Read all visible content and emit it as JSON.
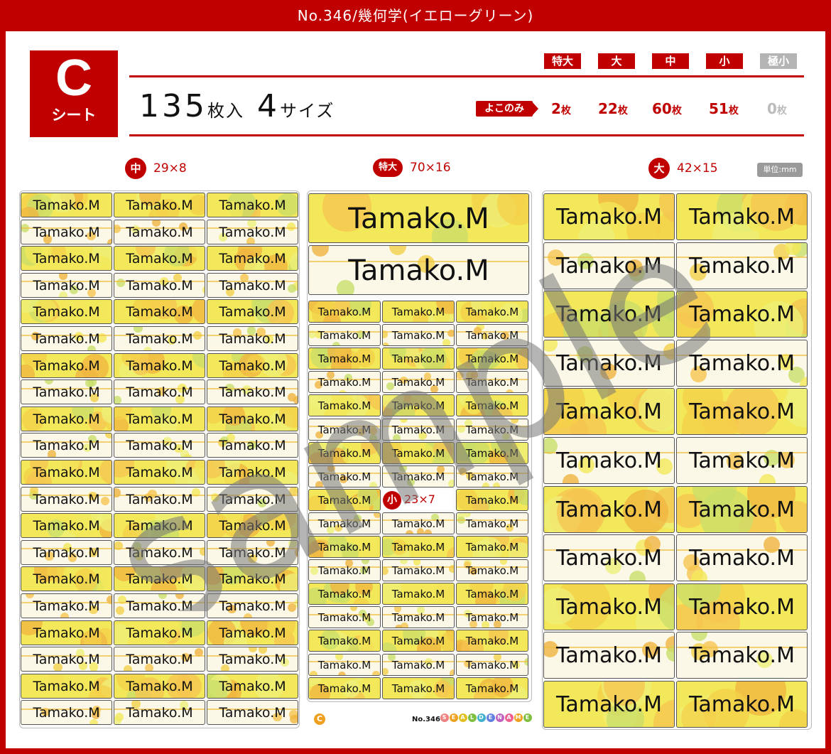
{
  "header": {
    "title": "No.346/幾何学(イエローグリーン)"
  },
  "sheet": {
    "letter": "C",
    "label": "シート"
  },
  "summary": {
    "count": "135",
    "count_unit": "枚入",
    "sizes": "4",
    "sizes_unit": "サイズ"
  },
  "size_tags": [
    "特大",
    "大",
    "中",
    "小",
    "極小"
  ],
  "yoko_label": "よこのみ",
  "counts": [
    {
      "num": "2",
      "unit": "枚"
    },
    {
      "num": "22",
      "unit": "枚"
    },
    {
      "num": "60",
      "unit": "枚"
    },
    {
      "num": "51",
      "unit": "枚"
    },
    {
      "num": "0",
      "unit": "枚"
    }
  ],
  "dimensions": {
    "medium": {
      "tag": "中",
      "size": "29×8"
    },
    "xlarge": {
      "tag": "特大",
      "size": "70×16"
    },
    "large": {
      "tag": "大",
      "size": "42×15"
    },
    "small": {
      "tag": "小",
      "size": "23×7"
    },
    "unit": "単位:mm"
  },
  "label_text": "Tamako.M",
  "watermark": "sample",
  "footer": {
    "sheet_mark": "C",
    "number": "No.346",
    "brand": "SEALDENAME"
  },
  "colors": {
    "brand_red": "#c00000",
    "yellow": "#f2e85a",
    "green": "#b8d860",
    "orange": "#f4b030",
    "disabled_gray": "#b4b4b4"
  }
}
